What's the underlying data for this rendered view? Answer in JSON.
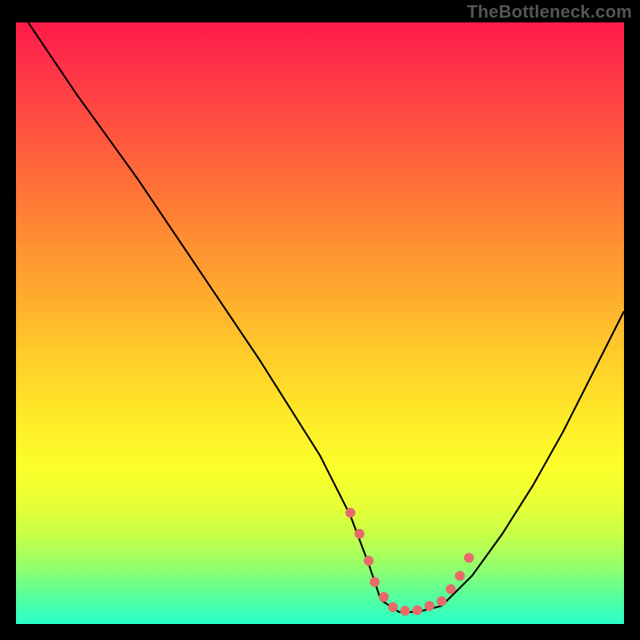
{
  "watermark": "TheBottleneck.com",
  "chart_data": {
    "type": "line",
    "title": "",
    "xlabel": "",
    "ylabel": "",
    "xlim": [
      0,
      100
    ],
    "ylim": [
      0,
      100
    ],
    "series": [
      {
        "name": "curve",
        "x": [
          2,
          10,
          20,
          30,
          40,
          50,
          55,
          58,
          60,
          63,
          66,
          70,
          75,
          80,
          85,
          90,
          95,
          100
        ],
        "values": [
          100,
          88,
          74,
          59,
          44,
          28,
          18,
          10,
          4,
          2,
          2,
          3,
          8,
          15,
          23,
          32,
          42,
          52
        ]
      }
    ],
    "markers": {
      "name": "dots",
      "x": [
        55,
        56.5,
        58,
        59,
        60.5,
        62,
        64,
        66,
        68,
        70,
        71.5,
        73,
        74.5
      ],
      "values": [
        18.5,
        15,
        10.5,
        7,
        4.5,
        2.8,
        2.2,
        2.3,
        3.0,
        3.8,
        5.8,
        8.0,
        11.0
      ]
    },
    "gradient_stops": [
      {
        "pct": 0,
        "color": "#ff1a4a"
      },
      {
        "pct": 50,
        "color": "#ffcb2a"
      },
      {
        "pct": 80,
        "color": "#e8ff34"
      },
      {
        "pct": 100,
        "color": "#29ffca"
      }
    ],
    "marker_color": "#e86a6a"
  }
}
